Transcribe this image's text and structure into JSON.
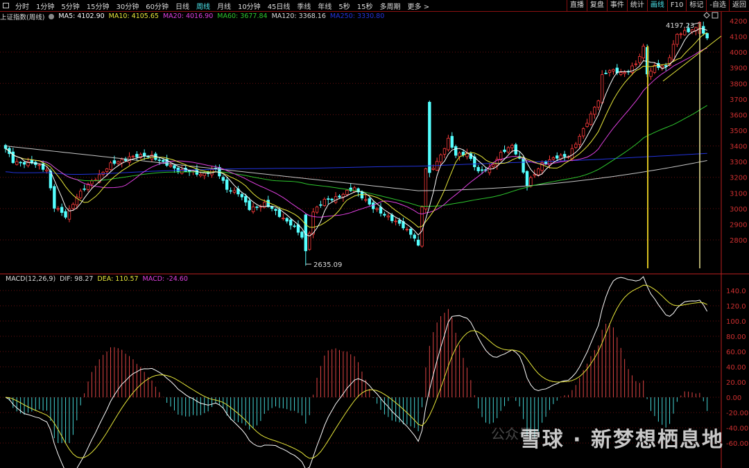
{
  "toolbar": {
    "items": [
      "分时",
      "1分钟",
      "5分钟",
      "15分钟",
      "30分钟",
      "60分钟",
      "日线",
      "周线",
      "月线",
      "10分钟",
      "45日线",
      "季线",
      "年线",
      "5秒",
      "15秒",
      "多周期",
      "更多 >"
    ],
    "active": "周线",
    "right_buttons": [
      "直播",
      "复盘",
      "事件",
      "统计",
      "画线",
      "F10",
      "标记",
      "-自选",
      "返回"
    ],
    "right_active": "画线"
  },
  "info": {
    "title": "上证指数(周线)",
    "ma5": "MA5: 4102.90",
    "ma10": "MA10: 4105.65",
    "ma20": "MA20: 4016.90",
    "ma60": "MA60: 3677.84",
    "ma120": "MA120: 3368.16",
    "ma250": "MA250: 3330.80"
  },
  "macd_info": {
    "name": "MACD(12,26,9)",
    "dif": "DIF: 98.27",
    "dea": "DEA: 110.57",
    "macd": "MACD: -24.60"
  },
  "annotations": {
    "high_label": "4197.23",
    "low_label": "2635.09"
  },
  "watermark": {
    "main": "雪球 · 新梦想栖息地",
    "sub": "公众号"
  },
  "colors": {
    "up": "#ff3b3b",
    "down": "#54ffff",
    "ma5": "#ffffff",
    "ma10": "#e8e83a",
    "ma20": "#e040e0",
    "ma60": "#2ec82e",
    "ma120": "#c8c8c8",
    "ma250": "#2233dd",
    "axis": "#c02020"
  },
  "chart_data": [
    {
      "type": "candlestick",
      "title": "上证指数(周线)",
      "ylim": [
        2700,
        4250
      ],
      "yticks": [
        4200,
        4100,
        4000,
        3900,
        3800,
        3700,
        3600,
        3500,
        3400,
        3300,
        3200,
        3100,
        3000,
        2900,
        2800
      ],
      "n_candles": 188,
      "price_path": [
        [
          0,
          3380
        ],
        [
          2,
          3300
        ],
        [
          7,
          3290
        ],
        [
          11,
          3250
        ],
        [
          13,
          3010
        ],
        [
          16,
          2950
        ],
        [
          19,
          3080
        ],
        [
          22,
          3150
        ],
        [
          28,
          3280
        ],
        [
          33,
          3330
        ],
        [
          39,
          3340
        ],
        [
          42,
          3290
        ],
        [
          46,
          3250
        ],
        [
          52,
          3220
        ],
        [
          56,
          3250
        ],
        [
          59,
          3130
        ],
        [
          62,
          3100
        ],
        [
          65,
          3000
        ],
        [
          69,
          3030
        ],
        [
          72,
          2980
        ],
        [
          76,
          2900
        ],
        [
          79,
          2820
        ],
        [
          80,
          2730
        ],
        [
          82,
          2980
        ],
        [
          85,
          3050
        ],
        [
          89,
          3080
        ],
        [
          93,
          3130
        ],
        [
          95,
          3080
        ],
        [
          98,
          3000
        ],
        [
          102,
          2950
        ],
        [
          106,
          2880
        ],
        [
          109,
          2820
        ],
        [
          110,
          2760
        ],
        [
          111,
          3000
        ],
        [
          112,
          3250
        ],
        [
          113,
          3230
        ],
        [
          115,
          3300
        ],
        [
          118,
          3440
        ],
        [
          120,
          3340
        ],
        [
          123,
          3360
        ],
        [
          126,
          3230
        ],
        [
          129,
          3260
        ],
        [
          132,
          3350
        ],
        [
          135,
          3400
        ],
        [
          137,
          3320
        ],
        [
          139,
          3150
        ],
        [
          143,
          3290
        ],
        [
          146,
          3320
        ],
        [
          150,
          3340
        ],
        [
          154,
          3500
        ],
        [
          158,
          3700
        ],
        [
          159,
          3850
        ],
        [
          161,
          3880
        ],
        [
          165,
          3870
        ],
        [
          168,
          3920
        ],
        [
          170,
          4030
        ],
        [
          171,
          3860
        ],
        [
          173,
          3910
        ],
        [
          176,
          3900
        ],
        [
          179,
          4120
        ],
        [
          182,
          4130
        ],
        [
          184,
          4150
        ],
        [
          185,
          4190
        ],
        [
          186,
          4120
        ],
        [
          187,
          4090
        ]
      ],
      "special_candles": [
        {
          "i": 80,
          "o": 2960,
          "c": 2730,
          "h": 2970,
          "l": 2635.09
        },
        {
          "i": 111,
          "o": 2760,
          "c": 3010,
          "h": 3020,
          "l": 2750
        },
        {
          "i": 113,
          "o": 3680,
          "c": 3230,
          "h": 3690,
          "l": 3200
        },
        {
          "i": 171,
          "o": 4030,
          "c": 3860,
          "h": 4050,
          "l": 3840
        },
        {
          "i": 185,
          "o": 4120,
          "c": 4190,
          "h": 4197.23,
          "l": 4100
        }
      ],
      "moving_averages": [
        "MA5",
        "MA10",
        "MA20",
        "MA60",
        "MA120",
        "MA250"
      ]
    },
    {
      "type": "line+bar",
      "title": "MACD(12,26,9)",
      "ylim": [
        -60,
        140
      ],
      "yticks": [
        "140.0",
        "120.0",
        "100.0",
        "80.00",
        "60.00",
        "40.00",
        "20.00",
        "0.00",
        "-20.00",
        "-40.00",
        "-60.00"
      ],
      "series": [
        "DIF",
        "DEA",
        "MACD"
      ],
      "last": {
        "DIF": 98.27,
        "DEA": 110.57,
        "MACD": -24.6
      }
    }
  ]
}
